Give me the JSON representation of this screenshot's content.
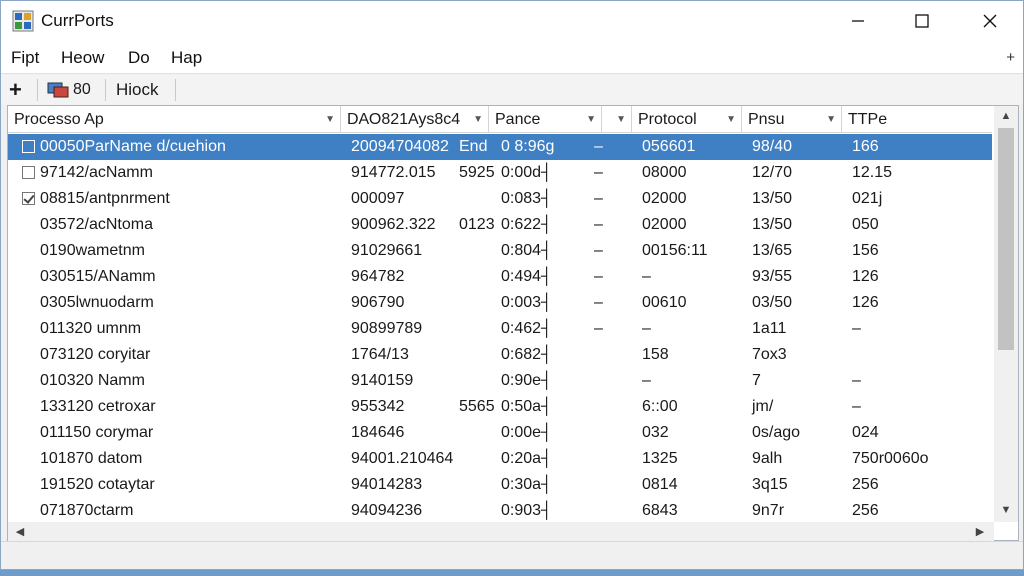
{
  "window": {
    "title": "CurrPorts",
    "controls": {
      "minimize": "minimize",
      "maximize": "maximize",
      "close": "close"
    }
  },
  "menu": {
    "items": [
      "Fipt",
      "Heow",
      "Do",
      "Hap"
    ],
    "pin": "+"
  },
  "toolbar": {
    "add_label": "+",
    "count_label": "80",
    "action_label": "Hiock"
  },
  "table": {
    "columns": [
      "Processo Ap",
      "DАО821Ays8c4",
      "Pance",
      "",
      "Protocol",
      "Pnsu",
      "TTPe"
    ],
    "rows": [
      {
        "check": "box",
        "cells": [
          "00050ParName d/cuehion",
          "20094704082",
          "End",
          "0 8:96g",
          "–",
          "056601",
          "98/40",
          "166"
        ]
      },
      {
        "check": "box",
        "cells": [
          "97142/acNamm",
          "914772.015",
          "5925",
          "0:00d┤",
          "–",
          "08000",
          "12/70",
          "12.15"
        ]
      },
      {
        "check": "checked",
        "cells": [
          "08815/antpnrment",
          "000097",
          "",
          "0:083┤",
          "–",
          "02000",
          "13/50",
          "021j"
        ]
      },
      {
        "check": "",
        "cells": [
          "03572/acNtoma",
          "900962.322",
          "0123",
          "0:622┤",
          "–",
          "02000",
          "13/50",
          "050"
        ]
      },
      {
        "check": "",
        "cells": [
          "0190wametnm",
          "91029661",
          "",
          "0:804┤",
          "–",
          "00156:11",
          "13/65",
          "156"
        ]
      },
      {
        "check": "",
        "cells": [
          "030515/ANamm",
          "964782",
          "",
          "0:494┤",
          "–",
          "–",
          "93/55",
          "126"
        ]
      },
      {
        "check": "",
        "cells": [
          "0305lwnuodarm",
          "906790",
          "",
          "0:003┤",
          "–",
          "00610",
          "03/50",
          "126"
        ]
      },
      {
        "check": "",
        "cells": [
          "011320 umnm",
          "90899789",
          "",
          "0:462┤",
          "–",
          "–",
          "1a11",
          "–"
        ]
      },
      {
        "check": "",
        "cells": [
          "073120 coryitar",
          "1764/13",
          "",
          "0:682┤",
          "",
          "158",
          "7ox3",
          ""
        ]
      },
      {
        "check": "",
        "cells": [
          "010320 Namm",
          "9140159",
          "",
          "0:90e┤",
          "",
          "–",
          "7",
          "–"
        ]
      },
      {
        "check": "",
        "cells": [
          "133120 cetroxar",
          "955342",
          "5565",
          "0:50a┤",
          "",
          "6::00",
          "jm/",
          "–"
        ]
      },
      {
        "check": "",
        "cells": [
          "011150 corymar",
          "184646",
          "",
          "0:00e┤",
          "",
          "032",
          "0s/ago",
          "024"
        ]
      },
      {
        "check": "",
        "cells": [
          "101870 datom",
          "94001.210464",
          "",
          "0:20a┤",
          "",
          "1325",
          "9alh",
          "750r0060o"
        ]
      },
      {
        "check": "",
        "cells": [
          "191520 cotaytar",
          "94014283",
          "",
          "0:30a┤",
          "",
          "0814",
          "3q15",
          "256"
        ]
      },
      {
        "check": "",
        "cells": [
          "071870ctarm",
          "94094236",
          "",
          "0:903┤",
          "",
          "6843",
          "9n7r",
          "256"
        ]
      }
    ],
    "selected_row": 0
  },
  "colors": {
    "selection": "#3f7fc4",
    "desktop": "#6f9bc9"
  }
}
